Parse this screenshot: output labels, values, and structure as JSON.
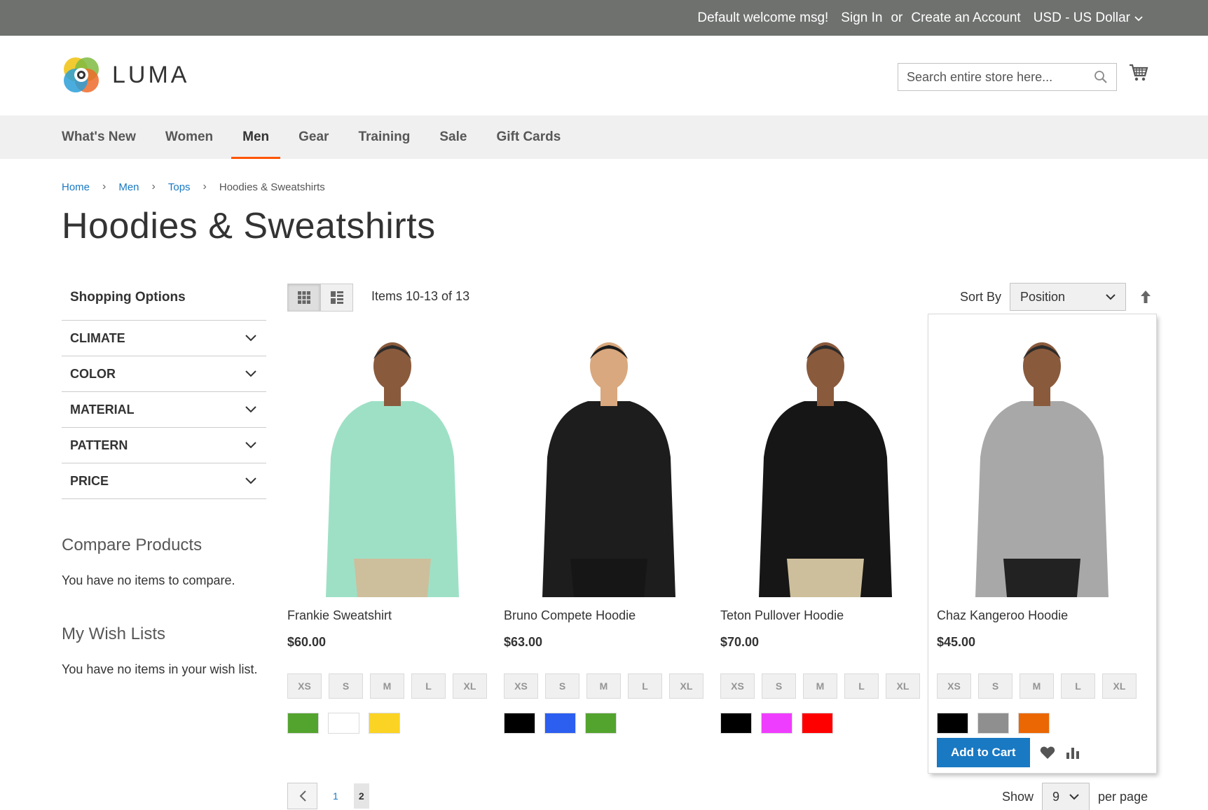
{
  "topbar": {
    "welcome": "Default welcome msg!",
    "sign_in": "Sign In",
    "or": "or",
    "create_account": "Create an Account",
    "currency": "USD - US Dollar"
  },
  "header": {
    "logo_text": "LUMA",
    "search_placeholder": "Search entire store here..."
  },
  "nav": {
    "items": [
      "What's New",
      "Women",
      "Men",
      "Gear",
      "Training",
      "Sale",
      "Gift Cards"
    ],
    "active": "Men"
  },
  "breadcrumb": {
    "items": [
      "Home",
      "Men",
      "Tops"
    ],
    "current": "Hoodies & Sweatshirts"
  },
  "page_title": "Hoodies & Sweatshirts",
  "sidebar": {
    "title": "Shopping Options",
    "filters": [
      "CLIMATE",
      "COLOR",
      "MATERIAL",
      "PATTERN",
      "PRICE"
    ],
    "compare_title": "Compare Products",
    "compare_text": "You have no items to compare.",
    "wishlist_title": "My Wish Lists",
    "wishlist_text": "You have no items in your wish list."
  },
  "toolbar": {
    "amount": "Items 10-13 of 13",
    "sort_label": "Sort By",
    "sort_value": "Position",
    "show_label": "Show",
    "limit_value": "9",
    "per_page_label": "per page"
  },
  "sizes": [
    "XS",
    "S",
    "M",
    "L",
    "XL"
  ],
  "products": [
    {
      "name": "Frankie Sweatshirt",
      "price": "$60.00",
      "colors": [
        "#53a42e",
        "#ffffff",
        "#fbd324"
      ],
      "shirt": "#9ee0c6",
      "hair": "#2b2b2b",
      "skin": "#8a5a3c",
      "pants": "#cdbf9c"
    },
    {
      "name": "Bruno Compete Hoodie",
      "price": "$63.00",
      "colors": [
        "#000000",
        "#2c5ff0",
        "#53a42e"
      ],
      "shirt": "#1d1d1d",
      "hair": "#1a1a1a",
      "skin": "#d9a87e",
      "pants": "#161616"
    },
    {
      "name": "Teton Pullover Hoodie",
      "price": "$70.00",
      "colors": [
        "#000000",
        "#ef3dff",
        "#ff0000"
      ],
      "shirt": "#161616",
      "hair": "#2b2b2b",
      "skin": "#8a5a3c",
      "pants": "#cdbf9c"
    },
    {
      "name": "Chaz Kangeroo Hoodie",
      "price": "$45.00",
      "colors": [
        "#000000",
        "#8f8f8f",
        "#eb6703"
      ],
      "shirt": "#a8a8a8",
      "hair": "#2b2b2b",
      "skin": "#8a5a3c",
      "pants": "#222222"
    }
  ],
  "hovered_product_action": "Add to Cart",
  "pager": {
    "pages": [
      "1",
      "2"
    ],
    "current": "2"
  },
  "colors": {
    "accent": "#1979c3",
    "nav_active_underline": "#ff5501",
    "topbar": "#6e716e"
  }
}
